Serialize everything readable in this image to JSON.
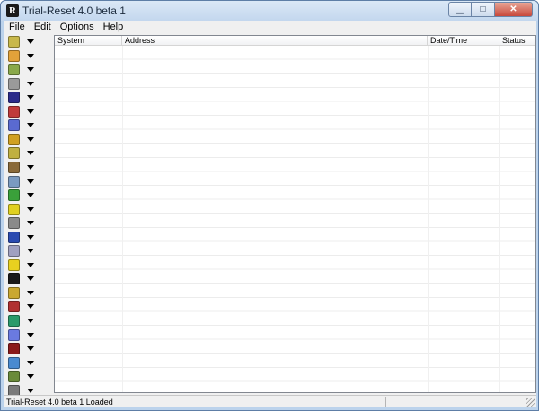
{
  "window": {
    "title": "Trial-Reset 4.0 beta 1",
    "app_icon_glyph": "R"
  },
  "menu": [
    "File",
    "Edit",
    "Options",
    "Help"
  ],
  "list": {
    "columns": [
      "System",
      "Address",
      "Date/Time",
      "Status"
    ]
  },
  "toolbar": {
    "buttons": [
      {
        "icon": "protection-icon-1",
        "color": "#c8b84a"
      },
      {
        "icon": "protection-icon-2",
        "color": "#e2a23a"
      },
      {
        "icon": "protection-icon-3",
        "color": "#8aa84a"
      },
      {
        "icon": "protection-icon-4",
        "color": "#9a9a9a"
      },
      {
        "icon": "protection-icon-5",
        "color": "#2a2a8a"
      },
      {
        "icon": "protection-icon-6",
        "color": "#c03a3a"
      },
      {
        "icon": "protection-icon-7",
        "color": "#5a6ad0"
      },
      {
        "icon": "protection-icon-8",
        "color": "#d0a020"
      },
      {
        "icon": "protection-icon-9",
        "color": "#c0b040"
      },
      {
        "icon": "protection-icon-10",
        "color": "#8a6a3a"
      },
      {
        "icon": "protection-icon-11",
        "color": "#7a9ac0"
      },
      {
        "icon": "protection-icon-12",
        "color": "#3aa03a"
      },
      {
        "icon": "protection-icon-13",
        "color": "#e0d020"
      },
      {
        "icon": "protection-icon-14",
        "color": "#8a8a8a"
      },
      {
        "icon": "protection-icon-15",
        "color": "#2a4ab0"
      },
      {
        "icon": "protection-icon-16",
        "color": "#a0a0c0"
      },
      {
        "icon": "protection-icon-17",
        "color": "#e8d020"
      },
      {
        "icon": "protection-icon-18",
        "color": "#1a1a1a"
      },
      {
        "icon": "protection-icon-19",
        "color": "#caa830"
      },
      {
        "icon": "protection-icon-20",
        "color": "#b03030"
      },
      {
        "icon": "protection-icon-21",
        "color": "#2a9a6a"
      },
      {
        "icon": "protection-icon-22",
        "color": "#6a7ae0"
      },
      {
        "icon": "protection-icon-23",
        "color": "#8a1a1a"
      },
      {
        "icon": "protection-icon-24",
        "color": "#4a8ad0"
      },
      {
        "icon": "protection-icon-25",
        "color": "#6a8a3a"
      },
      {
        "icon": "protection-icon-26",
        "color": "#7a7a7a"
      }
    ]
  },
  "status": {
    "text": "Trial-Reset 4.0 beta 1 Loaded"
  }
}
